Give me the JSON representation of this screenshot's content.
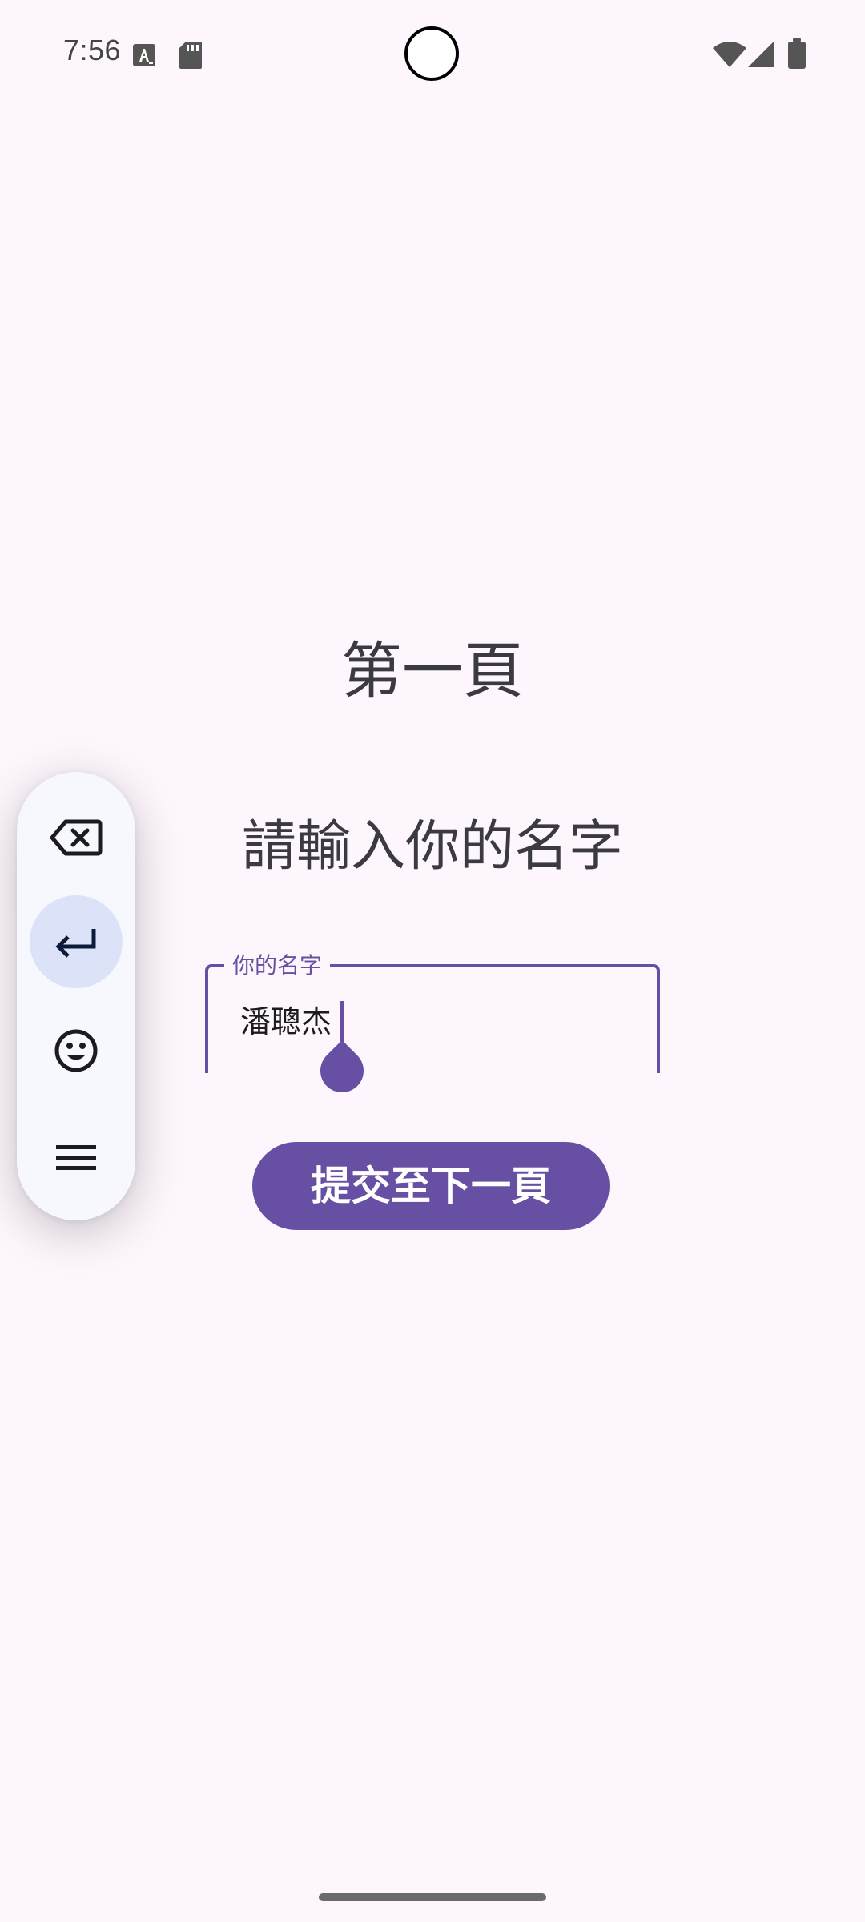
{
  "status_bar": {
    "time": "7:56",
    "icons": [
      "keyboard-a-icon",
      "sd-card-icon",
      "wifi-icon",
      "cell-signal-icon",
      "battery-icon"
    ]
  },
  "page": {
    "title": "第一頁",
    "prompt": "請輸入你的名字"
  },
  "name_field": {
    "label": "你的名字",
    "value": "潘聰杰"
  },
  "submit_button": {
    "label": "提交至下一頁"
  },
  "keyboard_toolbar": {
    "buttons": [
      "backspace-icon",
      "enter-icon",
      "emoji-icon",
      "menu-icon"
    ],
    "active": "enter-icon"
  },
  "colors": {
    "accent": "#6750a4",
    "background": "#fdf7fd",
    "text": "#3c3a41",
    "toolbar_bg": "#f6f8fd",
    "toolbar_active": "#dce3f9"
  }
}
